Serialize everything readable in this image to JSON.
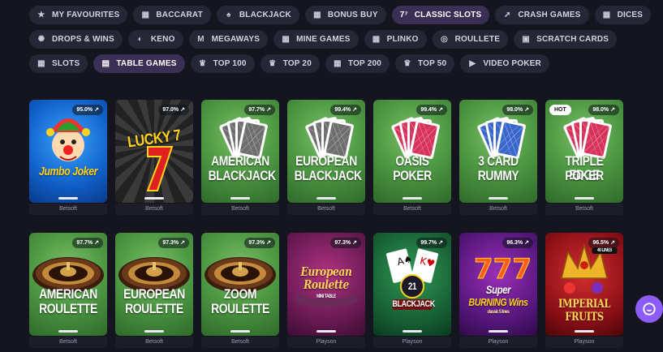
{
  "filters": {
    "row1": [
      {
        "label": "MY FAVOURITES",
        "icon": "star-icon"
      },
      {
        "label": "BACCARAT",
        "icon": "grid-icon"
      },
      {
        "label": "BLACKJACK",
        "icon": "spade-icon"
      },
      {
        "label": "BONUS BUY",
        "icon": "grid-icon"
      },
      {
        "label": "CLASSIC SLOTS",
        "icon": "slots-icon",
        "active": true
      },
      {
        "label": "CRASH GAMES",
        "icon": "rocket-icon"
      },
      {
        "label": "DICES",
        "icon": "grid-icon"
      }
    ],
    "row2": [
      {
        "label": "DROPS & WINS",
        "icon": "drops-icon"
      },
      {
        "label": "KENO",
        "icon": "keno-icon"
      },
      {
        "label": "MEGAWAYS",
        "icon": "megaways-icon"
      },
      {
        "label": "MINE GAMES",
        "icon": "grid-icon"
      },
      {
        "label": "PLINKO",
        "icon": "grid-icon"
      },
      {
        "label": "ROULLETE",
        "icon": "roulette-icon"
      },
      {
        "label": "SCRATCH CARDS",
        "icon": "scratch-icon"
      }
    ],
    "row3": [
      {
        "label": "SLOTS",
        "icon": "grid-icon"
      },
      {
        "label": "TABLE GAMES",
        "icon": "cards-icon",
        "active": true
      },
      {
        "label": "TOP 100",
        "icon": "crown-icon"
      },
      {
        "label": "TOP 20",
        "icon": "crown-icon"
      },
      {
        "label": "TOP 200",
        "icon": "grid-icon"
      },
      {
        "label": "TOP 50",
        "icon": "crown-icon"
      },
      {
        "label": "VIDEO POKER",
        "icon": "video-icon"
      }
    ]
  },
  "games": [
    {
      "title": "Jumbo Joker",
      "rtp": "95.0%",
      "provider": "Betsoft",
      "bg": "bg-blue",
      "art": "joker"
    },
    {
      "title": "LUCKY 7",
      "rtp": "97.0%",
      "provider": "Betsoft",
      "bg": "bg-dark",
      "art": "lucky"
    },
    {
      "title": "AMERICAN BLACKJACK",
      "line1": "AMERICAN",
      "line2": "BLACKJACK",
      "rtp": "97.7%",
      "provider": "Betsoft",
      "bg": "bg-green",
      "art": "cards-gray"
    },
    {
      "title": "EUROPEAN BLACKJACK",
      "line1": "EUROPEAN",
      "line2": "BLACKJACK",
      "rtp": "99.4%",
      "provider": "Betsoft",
      "bg": "bg-green",
      "art": "cards-gray"
    },
    {
      "title": "OASIS POKER",
      "line1": "OASIS",
      "line2": "POKER",
      "rtp": "99.4%",
      "provider": "Betsoft",
      "bg": "bg-green",
      "art": "cards-red"
    },
    {
      "title": "3 CARD RUMMY",
      "line1": "3 CARD",
      "line2": "RUMMY",
      "rtp": "98.0%",
      "provider": "Betsoft",
      "bg": "bg-green",
      "art": "cards-blue"
    },
    {
      "title": "TRIPLE EDGE POKER",
      "line1": "TRIPLE EDGE",
      "line2": "POKER",
      "rtp": "98.0%",
      "provider": "Betsoft",
      "bg": "bg-green",
      "art": "cards-red",
      "badge": "HOT"
    },
    {
      "title": "AMERICAN ROULETTE",
      "line1": "AMERICAN",
      "line2": "ROULETTE",
      "rtp": "97.7%",
      "provider": "Betsoft",
      "bg": "bg-green",
      "art": "wheel"
    },
    {
      "title": "EUROPEAN ROULETTE",
      "line1": "EUROPEAN",
      "line2": "ROULETTE",
      "rtp": "97.3%",
      "provider": "Betsoft",
      "bg": "bg-green",
      "art": "wheel"
    },
    {
      "title": "ZOOM ROULETTE",
      "line1": "ZOOM",
      "line2": "ROULETTE",
      "rtp": "97.3%",
      "provider": "Betsoft",
      "bg": "bg-green",
      "art": "wheel"
    },
    {
      "title": "European Roulette",
      "line1": "European",
      "line2": "Roulette",
      "sub": "MINI TABLE",
      "rtp": "97.3%",
      "provider": "Playson",
      "bg": "bg-purple",
      "art": "script"
    },
    {
      "title": "BLACKJACK",
      "line1": "21",
      "line2": "BLACKJACK",
      "rtp": "99.7%",
      "provider": "Playson",
      "bg": "bg-bj",
      "art": "bj"
    },
    {
      "title": "Super Burning Wins",
      "line1": "Super",
      "line2": "BURNING Wins",
      "sub": "classic 5 lines",
      "rtp": "96.3%",
      "provider": "Playson",
      "bg": "bg-violet",
      "art": "sevens"
    },
    {
      "title": "IMPERIAL FRUITS",
      "line1": "IMPERIAL",
      "line2": "FRUITS",
      "sub": "40 LINES",
      "rtp": "96.5%",
      "provider": "Playson",
      "bg": "bg-red",
      "art": "crown"
    }
  ],
  "chat": {
    "icon": "chat-icon"
  }
}
